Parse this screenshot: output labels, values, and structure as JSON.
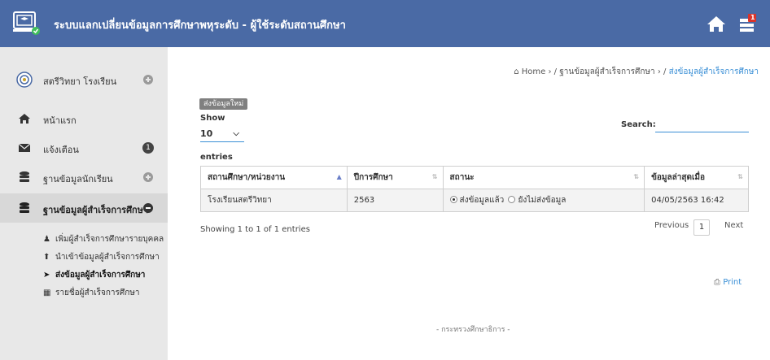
{
  "header": {
    "title": "ระบบแลกเปลี่ยนข้อมูลการศึกษาพหุระดับ - ผู้ใช้ระดับสถานศึกษา",
    "notification_count": "1",
    "colors": {
      "topbar": "#4a6aa5",
      "accent": "#3a8fd6"
    }
  },
  "sidebar": {
    "profile_name": "สตรีวิทยา โรงเรียน",
    "items": [
      {
        "label": "หน้าแรก",
        "icon": "home-icon"
      },
      {
        "label": "แจ้งเตือน",
        "icon": "envelope-icon",
        "badge": "1"
      },
      {
        "label": "ฐานข้อมูลนักเรียน",
        "icon": "database-icon"
      },
      {
        "label": "ฐานข้อมูลผู้สำเร็จการศึกษา",
        "icon": "database-icon"
      }
    ],
    "sub_items": [
      {
        "label": "เพิ่มผู้สำเร็จการศึกษารายบุคคล",
        "icon": "user-plus-icon"
      },
      {
        "label": "นำเข้าข้อมูลผู้สำเร็จการศึกษา",
        "icon": "upload-icon"
      },
      {
        "label": "ส่งข้อมูลผู้สำเร็จการศึกษา",
        "icon": "send-icon"
      },
      {
        "label": "รายชื่อผู้สำเร็จการศึกษา",
        "icon": "table-icon"
      }
    ]
  },
  "breadcrumb": {
    "home": "Home",
    "level1": "ฐานข้อมูลผู้สำเร็จการศึกษา",
    "current": "ส่งข้อมูลผู้สำเร็จการศึกษา"
  },
  "content": {
    "new_button": "ส่งข้อมูลใหม่",
    "show_label": "Show",
    "show_value": "10",
    "entries_label": "entries",
    "search_label": "Search:",
    "search_value": "",
    "table": {
      "headers": [
        "สถานศึกษา/หน่วยงาน",
        "ปีการศึกษา",
        "สถานะ",
        "ข้อมูลล่าสุดเมื่อ"
      ],
      "rows": [
        {
          "school": "โรงเรียนสตรีวิทยา",
          "year": "2563",
          "status_sent": "ส่งข้อมูลแล้ว",
          "status_unsent": "ยังไม่ส่งข้อมูล",
          "updated": "04/05/2563 16:42"
        }
      ]
    },
    "showing_text": "Showing 1 to 1 of 1 entries",
    "pager": {
      "previous": "Previous",
      "page": "1",
      "next": "Next"
    },
    "print_label": "Print"
  },
  "footer": {
    "text": "- กระทรวงศึกษาธิการ -"
  }
}
